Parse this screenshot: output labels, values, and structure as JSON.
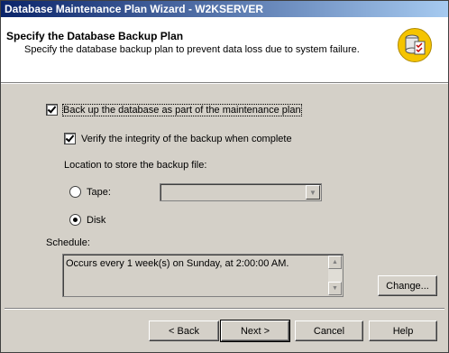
{
  "window": {
    "title": "Database Maintenance Plan Wizard - W2KSERVER"
  },
  "header": {
    "title": "Specify the Database Backup Plan",
    "subtitle": "Specify the database backup plan to prevent data loss due to system failure.",
    "icon": "database-checklist-icon"
  },
  "options": {
    "backup_db": {
      "label": "Back up the database as part of the maintenance plan",
      "checked": true
    },
    "verify": {
      "label": "Verify the integrity of the backup when complete",
      "checked": true
    },
    "location_label": "Location to store the backup file:",
    "tape": {
      "label": "Tape:",
      "selected": false,
      "value": ""
    },
    "disk": {
      "label": "Disk",
      "selected": true
    }
  },
  "schedule": {
    "label": "Schedule:",
    "text": "Occurs every 1 week(s) on Sunday, at 2:00:00 AM.",
    "change_label": "Change..."
  },
  "footer": {
    "back_label": "< Back",
    "next_label": "Next >",
    "cancel_label": "Cancel",
    "help_label": "Help"
  }
}
